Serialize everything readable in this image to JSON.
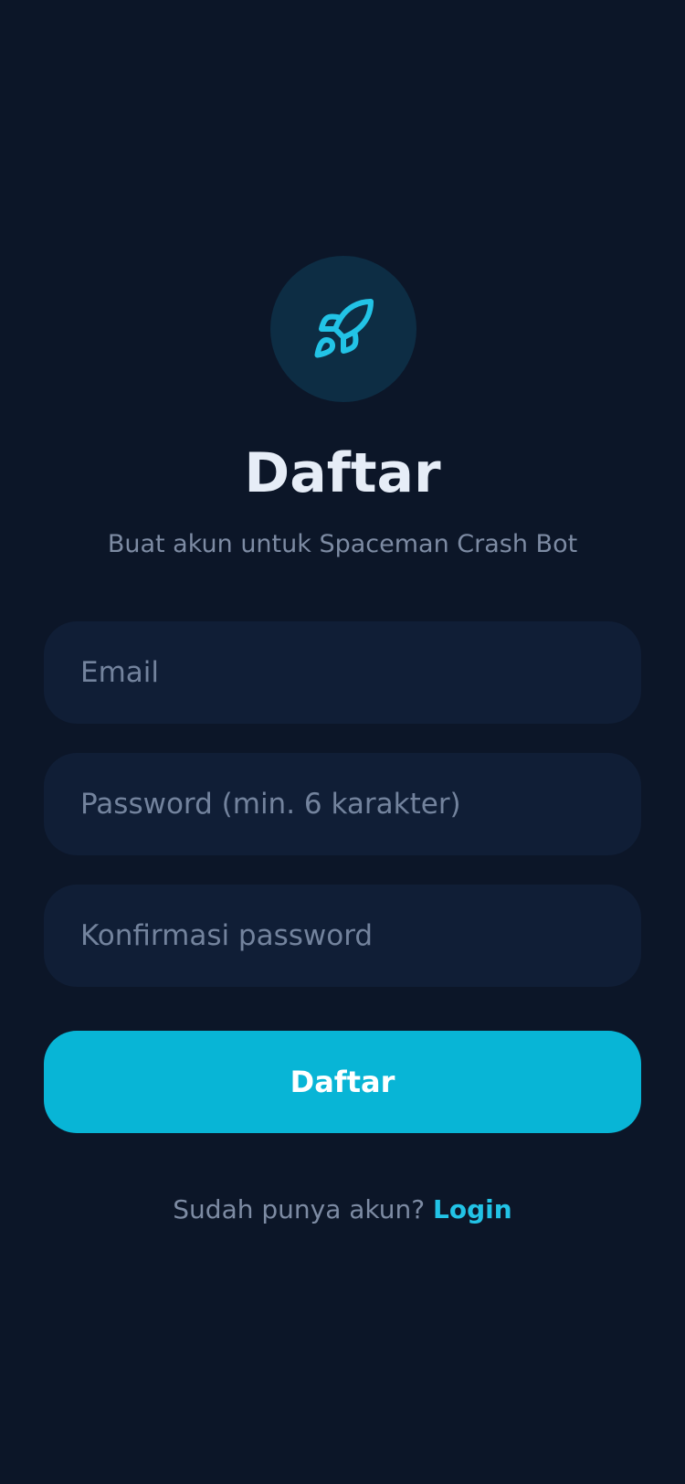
{
  "logo": {
    "icon": "rocket-icon",
    "icon_color": "#22c3e6",
    "bg_color": "#0d2d44"
  },
  "header": {
    "title": "Daftar",
    "subtitle": "Buat akun untuk Spaceman Crash Bot"
  },
  "form": {
    "email_placeholder": "Email",
    "password_placeholder": "Password (min. 6 karakter)",
    "confirm_placeholder": "Konfirmasi password",
    "submit_label": "Daftar"
  },
  "footer": {
    "prompt": "Sudah punya akun?",
    "login_label": "Login"
  },
  "colors": {
    "background": "#0c1628",
    "input_bg": "#101e36",
    "accent": "#08b5d6",
    "link": "#22c3e6"
  }
}
